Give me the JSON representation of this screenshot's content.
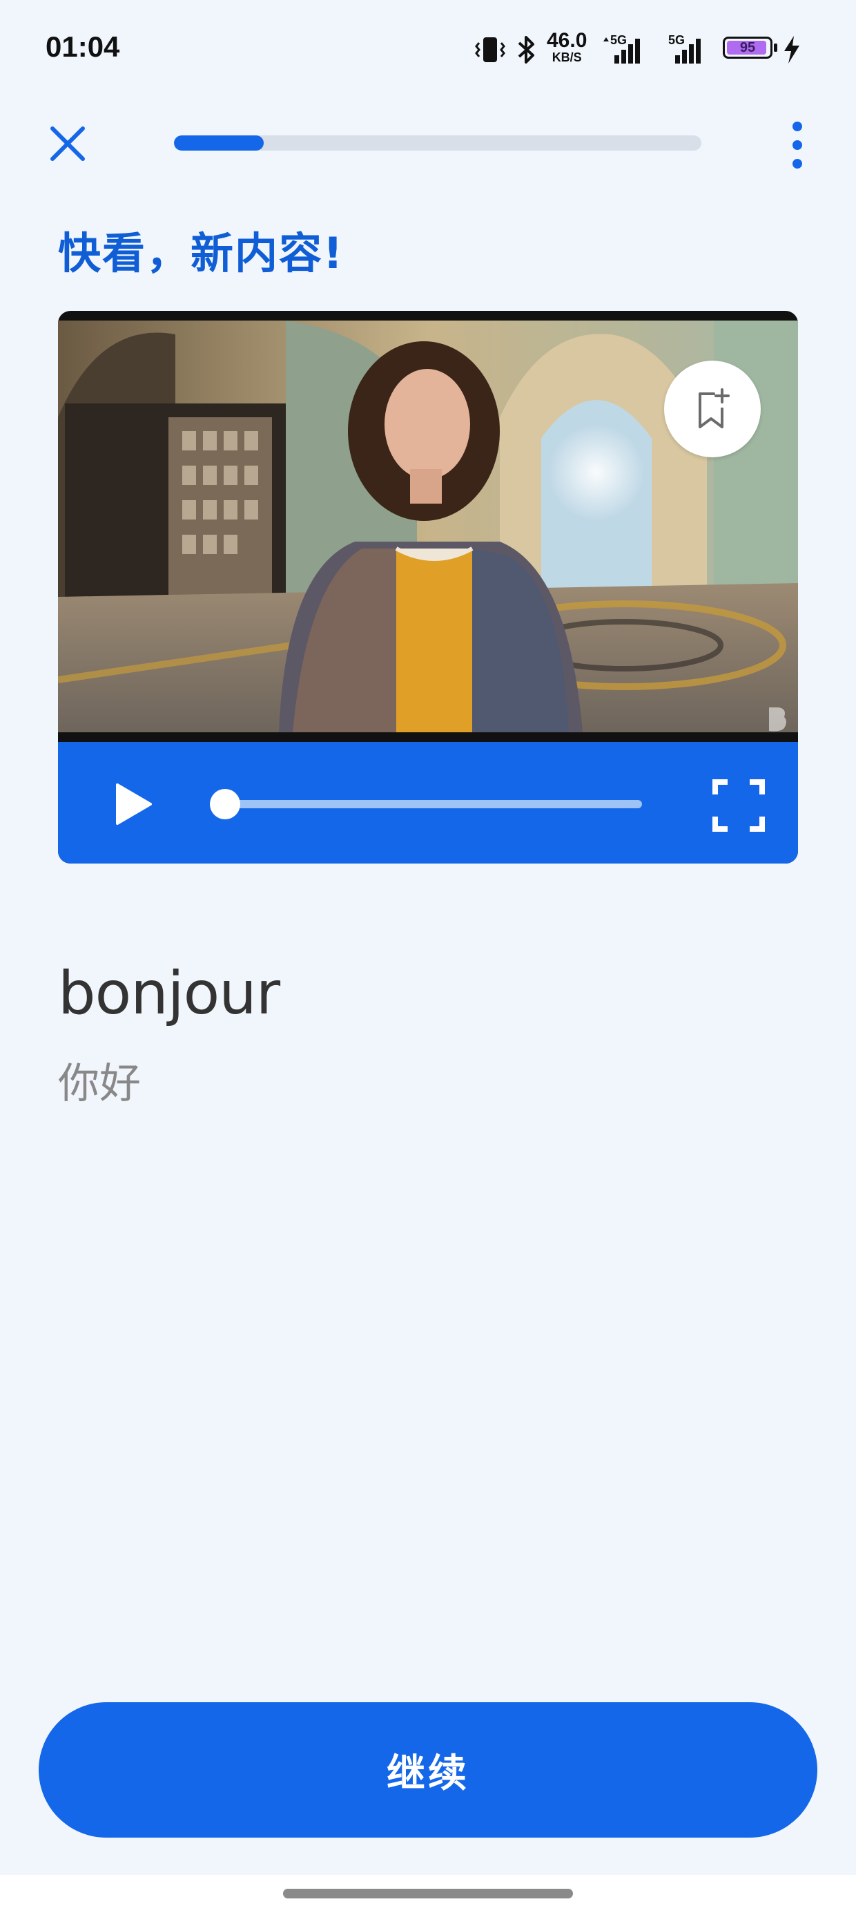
{
  "status_bar": {
    "time": "01:04",
    "net_rate": "46.0",
    "net_unit": "KB/S",
    "signal1_label": "5G",
    "signal2_label": "5G",
    "battery_level": "95",
    "icons": [
      "vibrate-icon",
      "bluetooth-icon",
      "signal-icon",
      "battery-icon",
      "charging-icon"
    ]
  },
  "header": {
    "progress_fraction": 0.17,
    "close_icon": "close-icon",
    "more_icon": "more-vertical-icon"
  },
  "lesson": {
    "title": "快看，新内容!",
    "word": "bonjour",
    "translation": "你好"
  },
  "video": {
    "bookmark_icon": "bookmark-add-icon",
    "play_icon": "play-icon",
    "fullscreen_icon": "fullscreen-icon",
    "seek_fraction": 0.0
  },
  "footer": {
    "continue_label": "继续"
  },
  "colors": {
    "accent": "#1467e8",
    "title": "#0f5ed6",
    "background": "#f1f6fd"
  }
}
